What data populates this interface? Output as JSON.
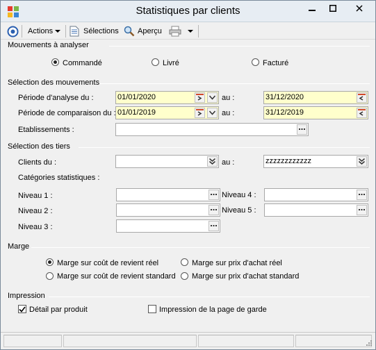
{
  "window": {
    "title": "Statistiques par clients"
  },
  "toolbar": {
    "actions": "Actions",
    "selections": "Sélections",
    "apercu": "Aperçu"
  },
  "mouvements": {
    "title": "Mouvements à analyser",
    "commande": "Commandé",
    "livre": "Livré",
    "facture": "Facturé",
    "selected": "Commandé"
  },
  "selection_mouvements": {
    "title": "Sélection des mouvements",
    "periode_analyse_label": "Période d'analyse du :",
    "periode_analyse_from": "01/01/2020",
    "periode_analyse_to": "31/12/2020",
    "periode_comparaison_label": "Période de comparaison du :",
    "periode_comparaison_from": "01/01/2019",
    "periode_comparaison_to": "31/12/2019",
    "au": "au :",
    "etablissements_label": "Etablissements :",
    "etablissements_value": ""
  },
  "selection_tiers": {
    "title": "Sélection des tiers",
    "clients_label": "Clients du :",
    "clients_from": "",
    "clients_to": "zzzzzzzzzzzz",
    "au": "au :",
    "categories_label": "Catégories statistiques :",
    "niveau1": "Niveau 1 :",
    "niveau2": "Niveau 2 :",
    "niveau3": "Niveau 3 :",
    "niveau4": "Niveau 4 :",
    "niveau5": "Niveau 5 :"
  },
  "marge": {
    "title": "Marge",
    "option1": "Marge sur coût de revient réel",
    "option2": "Marge sur coût de revient standard",
    "option3": "Marge sur prix d'achat réel",
    "option4": "Marge sur prix d'achat standard",
    "selected": "Marge sur coût de revient réel"
  },
  "impression": {
    "title": "Impression",
    "detail_produit": "Détail par produit",
    "detail_produit_checked": true,
    "page_garde": "Impression de la page de garde",
    "page_garde_checked": false
  }
}
